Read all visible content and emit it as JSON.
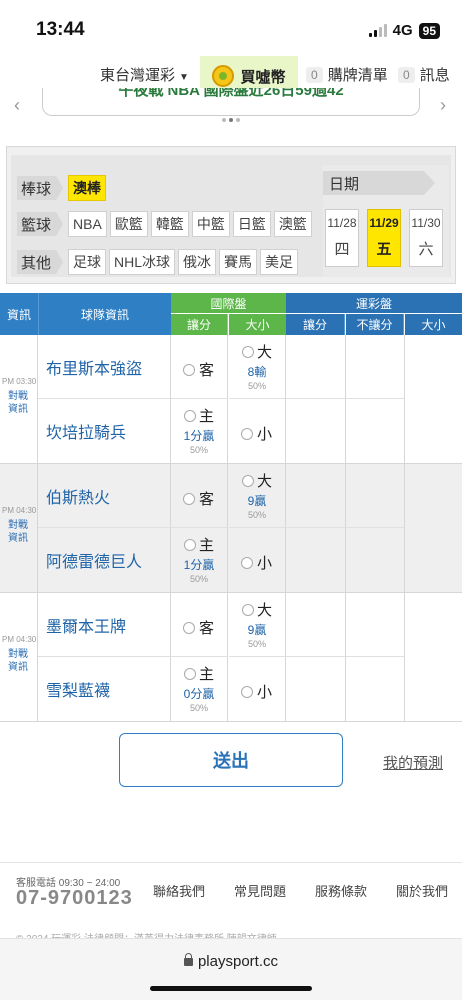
{
  "status_bar": {
    "time": "13:44",
    "network": "4G",
    "battery": "95"
  },
  "nav": {
    "region": "東台灣運彩",
    "coin_label": "買噓幣",
    "slip_label": "購牌清單",
    "slip_count": "0",
    "msg_label": "訊息",
    "msg_count": "0"
  },
  "banner": {
    "text": "午夜戰 NBA 國際盤近26日59過42"
  },
  "filters": {
    "rows": [
      {
        "category": "棒球",
        "tags": [
          {
            "label": "澳棒",
            "active": true
          }
        ]
      },
      {
        "category": "籃球",
        "tags": [
          {
            "label": "NBA"
          },
          {
            "label": "歐籃"
          },
          {
            "label": "韓籃"
          },
          {
            "label": "中籃"
          },
          {
            "label": "日籃"
          },
          {
            "label": "澳籃"
          }
        ]
      },
      {
        "category": "其他",
        "tags": [
          {
            "label": "足球"
          },
          {
            "label": "NHL冰球"
          },
          {
            "label": "俄冰"
          },
          {
            "label": "賽馬"
          },
          {
            "label": "美足"
          }
        ]
      }
    ],
    "date_label": "日期",
    "dates": [
      {
        "date": "11/28",
        "weekday": "四",
        "active": false
      },
      {
        "date": "11/29",
        "weekday": "五",
        "active": true
      },
      {
        "date": "11/30",
        "weekday": "六",
        "active": false
      }
    ]
  },
  "table": {
    "headers": {
      "info": "資訊",
      "team": "球隊資訊",
      "intl_group": "國際盤",
      "intl_spread": "讓分",
      "intl_total": "大小",
      "lottery_group": "運彩盤",
      "lottery_spread": "讓分",
      "lottery_nospread": "不讓分",
      "lottery_total": "大小"
    },
    "matches": [
      {
        "time": "PM 03:30",
        "info_link": "對戰資訊",
        "away": "布里斯本強盜",
        "home": "坎培拉騎兵",
        "away_pick": "客",
        "home_pick": "主",
        "home_line": "1分贏",
        "home_pct": "50%",
        "over": "大",
        "over_line": "8輸",
        "over_pct": "50%",
        "under": "小"
      },
      {
        "time": "PM 04:30",
        "info_link": "對戰資訊",
        "away": "伯斯熱火",
        "home": "阿德雷德巨人",
        "away_pick": "客",
        "home_pick": "主",
        "home_line": "1分贏",
        "home_pct": "50%",
        "over": "大",
        "over_line": "9贏",
        "over_pct": "50%",
        "under": "小"
      },
      {
        "time": "PM 04:30",
        "info_link": "對戰資訊",
        "away": "墨爾本王牌",
        "home": "雪梨藍襪",
        "away_pick": "客",
        "home_pick": "主",
        "home_line": "0分贏",
        "home_pct": "50%",
        "over": "大",
        "over_line": "9贏",
        "over_pct": "50%",
        "under": "小"
      }
    ]
  },
  "actions": {
    "submit": "送出",
    "my_predictions": "我的預測"
  },
  "footer": {
    "service_label": "客服電話 09:30 ~ 24:00",
    "phone": "07-9700123",
    "links": [
      "聯絡我們",
      "常見問題",
      "服務條款",
      "關於我們"
    ],
    "copyright": "© 2024 玩運彩 法律顧問：漢英得力法律事務所 陳韻文律師"
  },
  "browser": {
    "url": "playsport.cc"
  },
  "colors": {
    "header_blue": "#2e7fc4",
    "header_green": "#5cb64a",
    "active_yellow": "#ffe600",
    "link_blue": "#1f64a8"
  }
}
